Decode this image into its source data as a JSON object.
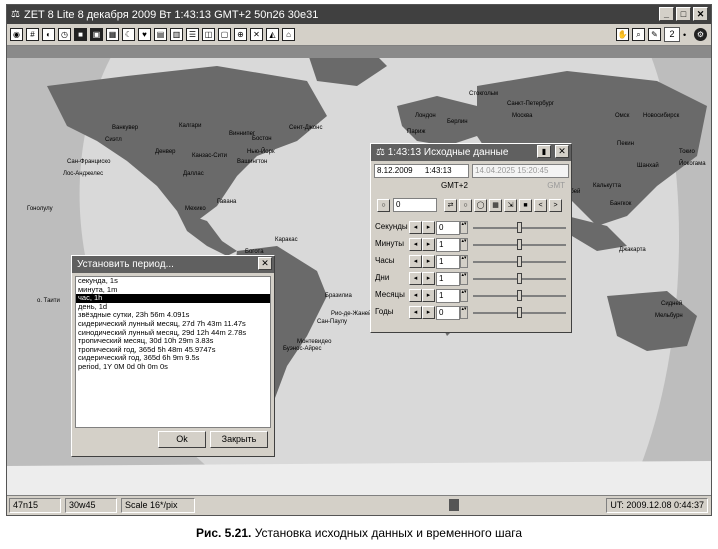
{
  "window": {
    "title": "ZET 8 Lite   8 декабря 2009  Вт   1:43:13 GMT+2 50n26  30e31",
    "min_glyph": "_",
    "max_glyph": "□",
    "close_glyph": "✕"
  },
  "toolbar": {
    "icons_left": [
      "compass-icon",
      "grid-icon",
      "globe-icon",
      "clock-icon",
      "black-square-icon",
      "dark-square-icon",
      "table-icon",
      "moon-icon",
      "heart-icon",
      "chart-icon",
      "calendar-icon",
      "list-icon",
      "layers-icon",
      "frame-icon",
      "zoom-icon",
      "cross-icon",
      "aspect-icon",
      "house-icon"
    ],
    "field_value": "2"
  },
  "map_labels": [
    "Ванкувер",
    "Сиэтл",
    "Калгари",
    "Виннипег",
    "Сент-Джонс",
    "Сан-Франциско",
    "Лос-Анджелес",
    "Денвер",
    "Бостон",
    "Нью-Йорк",
    "Вашингтон",
    "Канзас-Сити",
    "Даллас",
    "Мехико",
    "Гавана",
    "Богота",
    "Каракас",
    "Лима",
    "Сантьяго",
    "Буэнос-Айрес",
    "Монтевидео",
    "Рио-де-Жанейро",
    "Сан-Паулу",
    "Бразилиа",
    "Дакар",
    "Лагос",
    "Киншаса",
    "Найроби",
    "Санкт-Петербург",
    "Москва",
    "Лондон",
    "Париж",
    "Берлин",
    "Каир",
    "Стокгольм",
    "Омск",
    "Новосибирск",
    "Тегеран",
    "Карачи",
    "Бомбей",
    "Пекин",
    "Шанхай",
    "Токио",
    "Йокогама",
    "Калькутта",
    "Бангкок",
    "Джакарта",
    "Сидней",
    "Мельбурн",
    "Гонолулу",
    "о. Таити"
  ],
  "period_dialog": {
    "title": "Установить период...",
    "items": [
      "секунда, 1s",
      "минута, 1m",
      "час, 1h",
      "день, 1d",
      "звёздные сутки, 23h 56m 4.091s",
      "сидерический лунный месяц, 27d 7h 43m 11.47s",
      "синодический лунный месяц, 29d 12h 44m 2.78s",
      "тропический месяц, 30d 10h 29m 3.83s",
      "тропический год, 365d 5h 48m 45.9747s",
      "сидерический год, 365d 6h 9m 9.5s",
      "period, 1Y 0M 0d 0h 0m 0s"
    ],
    "selected_index": 2,
    "ok_label": "Ok",
    "close_label": "Закрыть"
  },
  "initial_dialog": {
    "title": "1:43:13 Исходные данные",
    "date": "8.12.2009",
    "time": "1:43:13",
    "alt_datetime": "14.04.2025  15:20:45",
    "gmt_label": "GMT+2",
    "gmt_right": "GMT",
    "step_value": "0",
    "rows": [
      {
        "label": "Секунды",
        "value": "0",
        "level": 0.5
      },
      {
        "label": "Минуты",
        "value": "1",
        "level": 0.5
      },
      {
        "label": "Часы",
        "value": "1",
        "level": 0.5
      },
      {
        "label": "Дни",
        "value": "1",
        "level": 0.5
      },
      {
        "label": "Месяцы",
        "value": "1",
        "level": 0.5
      },
      {
        "label": "Годы",
        "value": "0",
        "level": 0.5
      }
    ]
  },
  "status": {
    "lat": "47n15",
    "lon": "30w45",
    "scale": "Scale 16*/pix",
    "ut": "UT: 2009.12.08  0:44:37"
  },
  "caption": {
    "fig": "Рис. 5.21.",
    "text": " Установка исходных данных и временного шага"
  }
}
